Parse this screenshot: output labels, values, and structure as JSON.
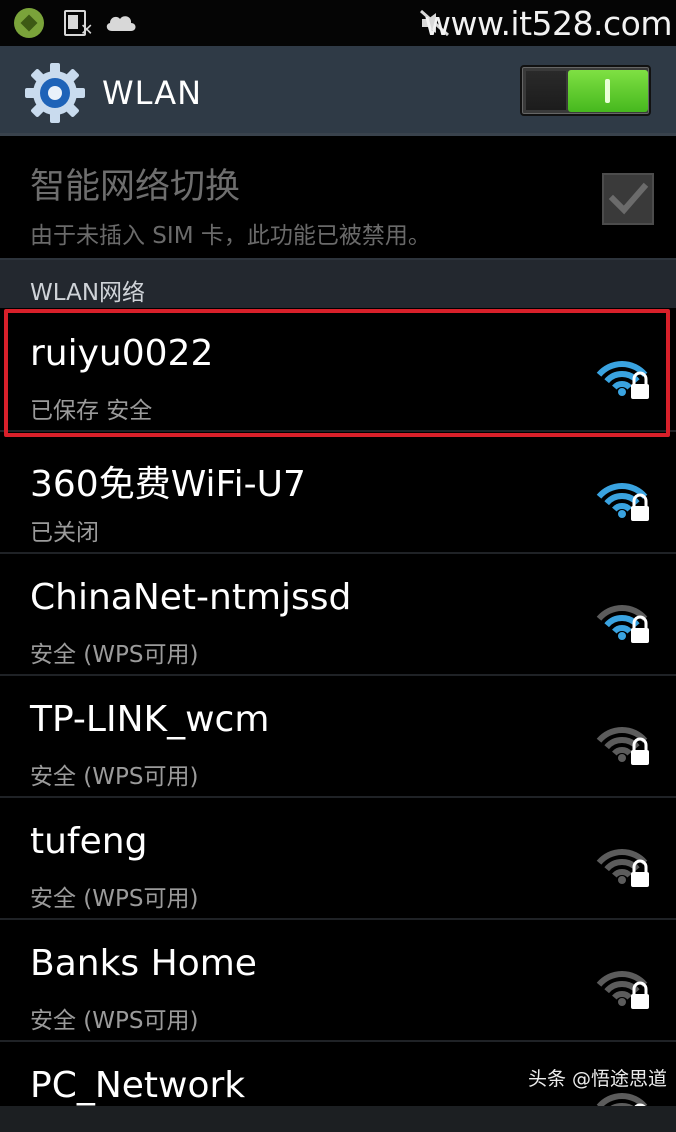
{
  "status_bar": {
    "watermark": "www.it528.com",
    "icons": [
      "app-icon",
      "sim-missing-icon",
      "cloud-icon",
      "mute-icon"
    ]
  },
  "header": {
    "title": "WLAN",
    "icon": "gear-icon",
    "toggle_on": true,
    "toggle_color": "#4fc424"
  },
  "smart_switch": {
    "title": "智能网络切换",
    "subtitle": "由于未插入 SIM 卡，此功能已被禁用。",
    "checked": true
  },
  "section": {
    "label": "WLAN网络"
  },
  "networks": [
    {
      "name": "ruiyu0022",
      "status": "已保存 安全",
      "signal": 3,
      "active": true
    },
    {
      "name": "360免费WiFi-U7",
      "status": "已关闭",
      "signal": 3,
      "active": true
    },
    {
      "name": "ChinaNet-ntmjssd",
      "status": "安全 (WPS可用)",
      "signal": 2,
      "active": true
    },
    {
      "name": "TP-LINK_wcm",
      "status": "安全 (WPS可用)",
      "signal": 0,
      "active": false
    },
    {
      "name": "tufeng",
      "status": "安全 (WPS可用)",
      "signal": 0,
      "active": false
    },
    {
      "name": "Banks Home",
      "status": "安全 (WPS可用)",
      "signal": 0,
      "active": false
    },
    {
      "name": "PC_Network",
      "status": "",
      "signal": 0,
      "active": false
    }
  ],
  "colors": {
    "wifi_active": "#3aa3e0",
    "wifi_inactive": "#5c5c5c",
    "highlight": "#d8202a"
  },
  "footer": {
    "watermark": "头条 @悟途思道"
  }
}
